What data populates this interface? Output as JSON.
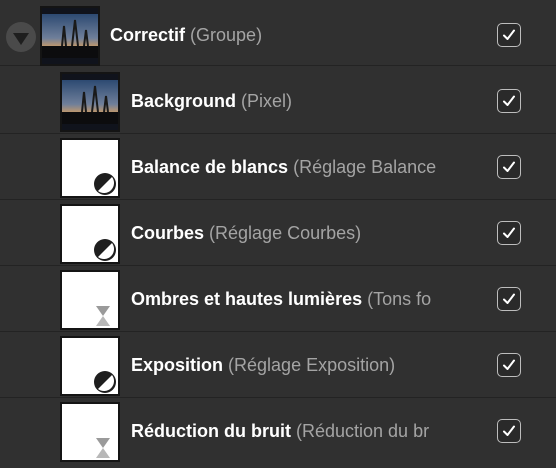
{
  "layers": [
    {
      "name": "Correctif",
      "type": "(Groupe)",
      "checked": true,
      "thumbnail": "photo",
      "expander": "triangle-down-icon"
    },
    {
      "name": "Background",
      "type": "(Pixel)",
      "checked": true,
      "thumbnail": "photo"
    },
    {
      "name": "Balance de blancs",
      "type": "(Réglage Balance",
      "checked": true,
      "thumbnail": "adjustment-icon"
    },
    {
      "name": "Courbes",
      "type": "(Réglage Courbes)",
      "checked": true,
      "thumbnail": "adjustment-icon"
    },
    {
      "name": "Ombres et hautes lumières",
      "type": "(Tons fo",
      "checked": true,
      "thumbnail": "hourglass-icon"
    },
    {
      "name": "Exposition",
      "type": "(Réglage Exposition)",
      "checked": true,
      "thumbnail": "adjustment-icon"
    },
    {
      "name": "Réduction du bruit",
      "type": "(Réduction du br",
      "checked": true,
      "thumbnail": "hourglass-icon"
    }
  ]
}
